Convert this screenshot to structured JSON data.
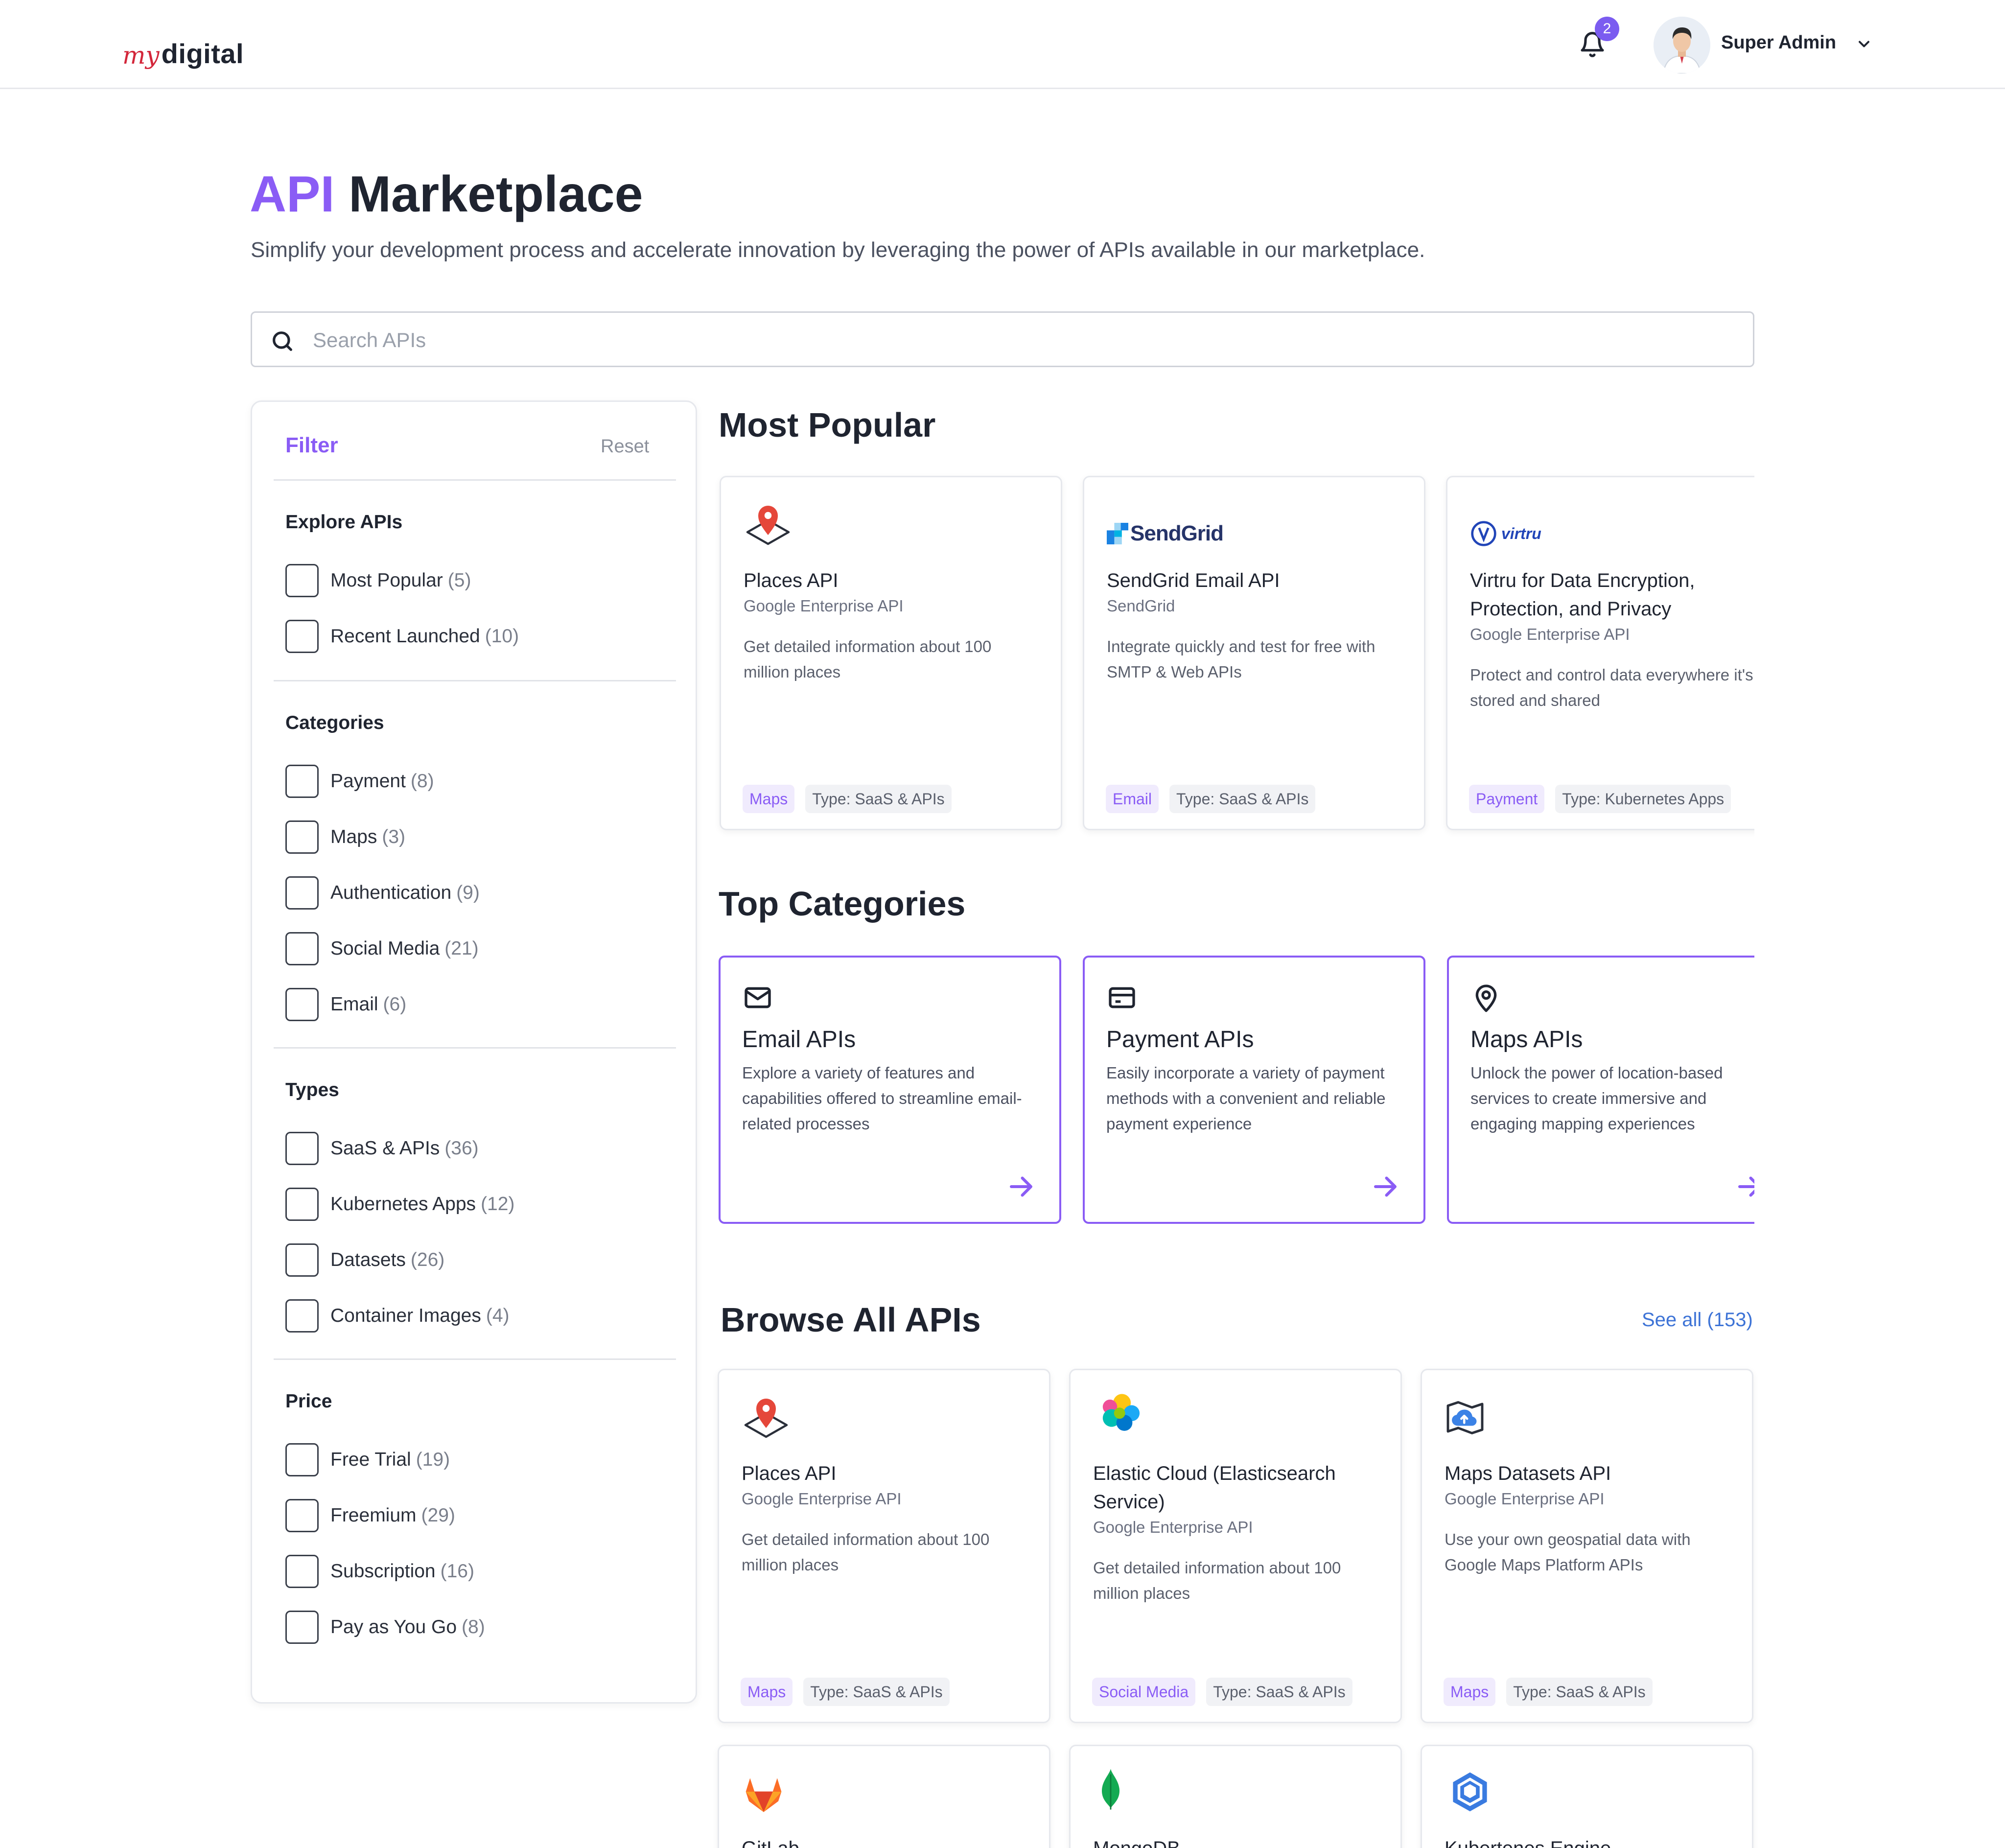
{
  "header": {
    "logo_my": "my",
    "logo_digital": "digital",
    "notification_count": "2",
    "user_name": "Super Admin"
  },
  "page": {
    "title_accent": "API",
    "title_rest": "Marketplace",
    "subtitle": "Simplify your development process and accelerate innovation by leveraging the power of APIs available in our marketplace."
  },
  "search": {
    "placeholder": "Search APIs"
  },
  "filter": {
    "title": "Filter",
    "reset": "Reset",
    "sections": [
      {
        "label": "Explore APIs",
        "items": [
          {
            "label": "Most Popular",
            "count": "(5)"
          },
          {
            "label": "Recent Launched",
            "count": "(10)"
          }
        ]
      },
      {
        "label": "Categories",
        "items": [
          {
            "label": "Payment",
            "count": "(8)"
          },
          {
            "label": "Maps",
            "count": "(3)"
          },
          {
            "label": "Authentication",
            "count": "(9)"
          },
          {
            "label": "Social Media",
            "count": "(21)"
          },
          {
            "label": "Email",
            "count": "(6)"
          }
        ]
      },
      {
        "label": "Types",
        "items": [
          {
            "label": "SaaS & APIs",
            "count": "(36)"
          },
          {
            "label": "Kubernetes Apps",
            "count": "(12)"
          },
          {
            "label": "Datasets",
            "count": "(26)"
          },
          {
            "label": "Container Images",
            "count": "(4)"
          }
        ]
      },
      {
        "label": "Price",
        "items": [
          {
            "label": "Free Trial",
            "count": "(19)"
          },
          {
            "label": "Freemium",
            "count": "(29)"
          },
          {
            "label": "Subscription",
            "count": "(16)"
          },
          {
            "label": "Pay as You Go",
            "count": "(8)"
          }
        ]
      }
    ]
  },
  "most_popular": {
    "title": "Most Popular",
    "cards": [
      {
        "icon": "map-pin-icon",
        "name": "Places API",
        "provider": "Google Enterprise API",
        "description": "Get detailed information about 100 million places",
        "category": "Maps",
        "type": "Type: SaaS & APIs"
      },
      {
        "icon": "sendgrid-logo",
        "logo_text": "SendGrid",
        "name": "SendGrid Email API",
        "provider": "SendGrid",
        "description": "Integrate quickly and test for free with SMTP & Web APIs",
        "category": "Email",
        "type": "Type: SaaS & APIs"
      },
      {
        "icon": "virtru-logo",
        "logo_text": "virtru",
        "name": "Virtru for Data Encryption, Protection, and Privacy",
        "provider": "Google Enterprise API",
        "description": "Protect and control data everywhere it's stored and shared",
        "category": "Payment",
        "type": "Type: Kubernetes Apps"
      }
    ]
  },
  "top_categories": {
    "title": "Top Categories",
    "cards": [
      {
        "icon": "mail-icon",
        "name": "Email APIs",
        "description": "Explore a variety of features and capabilities offered to streamline email-related processes"
      },
      {
        "icon": "credit-card-icon",
        "name": "Payment APIs",
        "description": "Easily incorporate a variety of payment methods with a convenient and reliable payment experience"
      },
      {
        "icon": "location-icon",
        "name": "Maps APIs",
        "description": "Unlock the power of location-based services to create immersive and engaging mapping experiences"
      }
    ]
  },
  "browse_all": {
    "title": "Browse All APIs",
    "see_all": "See all (153)",
    "cards": [
      {
        "icon": "map-pin-icon",
        "name": "Places API",
        "provider": "Google Enterprise API",
        "description": "Get detailed information about 100 million places",
        "category": "Maps",
        "type": "Type: SaaS & APIs"
      },
      {
        "icon": "elastic-logo",
        "name": "Elastic Cloud (Elasticsearch Service)",
        "provider": "Google Enterprise API",
        "description": "Get detailed information about 100 million places",
        "category": "Social Media",
        "type": "Type: SaaS & APIs"
      },
      {
        "icon": "map-upload-icon",
        "name": "Maps Datasets API",
        "provider": "Google Enterprise API",
        "description": "Use your own geospatial data with Google Maps Platform APIs",
        "category": "Maps",
        "type": "Type: SaaS & APIs"
      },
      {
        "icon": "gitlab-logo",
        "name": "GitLab"
      },
      {
        "icon": "mongodb-logo",
        "name": "MongoDB"
      },
      {
        "icon": "kubernetes-engine-logo",
        "name": "Kubertenes Engine"
      }
    ]
  }
}
